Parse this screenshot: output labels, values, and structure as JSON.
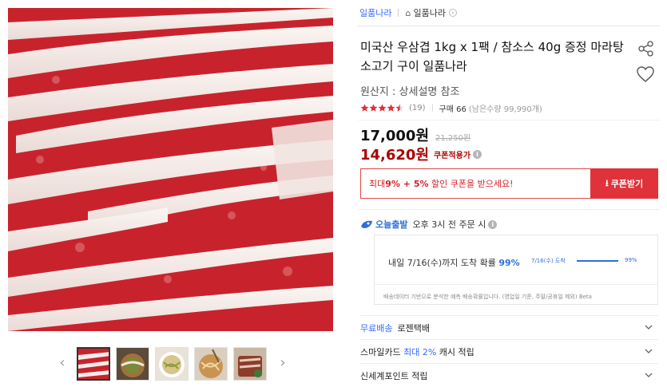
{
  "seller_bar": {
    "brand": "일품나라",
    "store": "일품나라"
  },
  "product": {
    "title": "미국산 우삼겹 1kg x 1팩 / 참소스 40g 증정 마라탕 소고기 구이 일품나라",
    "origin": "원산지 : 상세설명 참조",
    "rating": {
      "stars": 4.5,
      "review_count": "(19)",
      "purchase": "구매 66",
      "remaining": "(남은수량 99,990개)"
    },
    "price": "17,000원",
    "original_price": "21,250원",
    "coupon_price": "14,620원",
    "coupon_price_label": "쿠폰적용가",
    "coupon_banner": {
      "prefix": "최대 ",
      "rate1": "9%",
      "plus": " + ",
      "rate2": "5%",
      "suffix": " 할인 쿠폰을 받으세요!"
    },
    "coupon_button": "쿠폰받기"
  },
  "delivery": {
    "badge": "오늘출발",
    "cutoff": "오후 3시 전 주문 시",
    "arrival_text": "내일 7/16(수)까지 도착 확률 ",
    "arrival_pct": "99%",
    "mini_label": "7/16(수) 도착",
    "mini_pct": "99%",
    "mini_fraction": 0.99,
    "note": "배송데이터 기반으로 분석한 예측 배송확률입니다. (영업일 기준, 주말/공휴일 제외) Beta"
  },
  "options": [
    {
      "label": "무료배송",
      "value": "로젠택배"
    },
    {
      "label": "스마일카드 ",
      "highlight": "최대 2%",
      "value": " 캐시 적립"
    },
    {
      "label": "신세계포인트 적립"
    }
  ],
  "colors": {
    "accent_red": "#e0323a",
    "price_red": "#ae0000",
    "blue": "#2f6fd6",
    "link_blue": "#346aff"
  },
  "icons": [
    "house-icon",
    "chevron-right-icon",
    "share-icon",
    "heart-icon",
    "star-icon",
    "info-icon",
    "download-icon",
    "rocket-icon",
    "chevron-down-icon",
    "chevron-left-icon"
  ]
}
